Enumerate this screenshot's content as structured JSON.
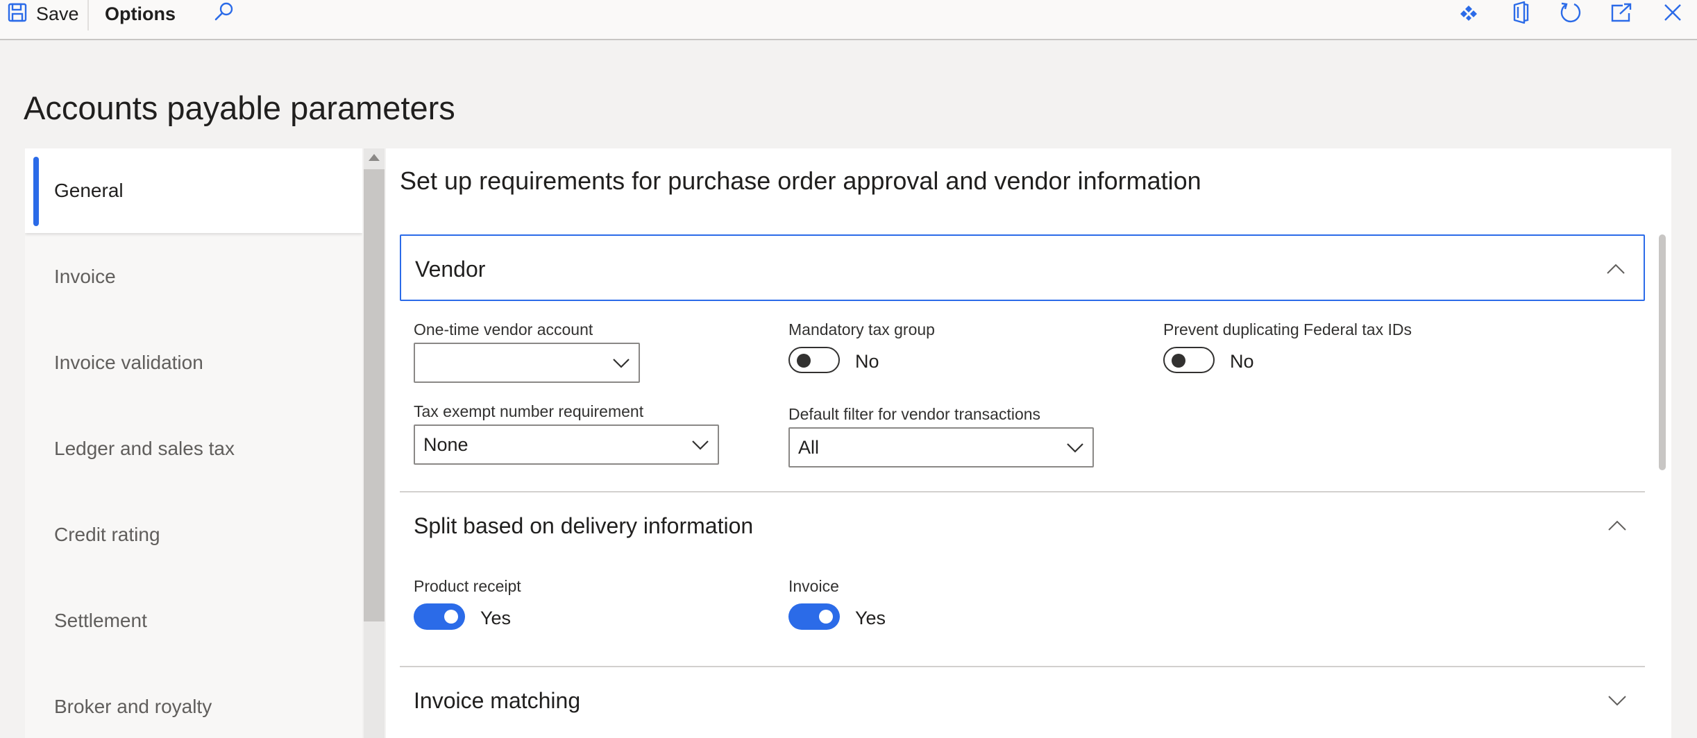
{
  "toolbar": {
    "save_label": "Save",
    "options_label": "Options",
    "icons": [
      "save-icon",
      "search-icon",
      "diamond-icon",
      "office-icon",
      "refresh-icon",
      "open-new-window-icon",
      "close-icon"
    ]
  },
  "page": {
    "title": "Accounts payable parameters"
  },
  "nav": {
    "items": [
      {
        "label": "General",
        "selected": true
      },
      {
        "label": "Invoice"
      },
      {
        "label": "Invoice validation"
      },
      {
        "label": "Ledger and sales tax"
      },
      {
        "label": "Credit rating"
      },
      {
        "label": "Settlement"
      },
      {
        "label": "Broker and royalty"
      }
    ]
  },
  "main": {
    "heading": "Set up requirements for purchase order approval and vendor information",
    "vendor": {
      "title": "Vendor",
      "one_time_vendor_account": {
        "label": "One-time vendor account",
        "value": ""
      },
      "mandatory_tax_group": {
        "label": "Mandatory tax group",
        "state": "No"
      },
      "prevent_duplicating": {
        "label": "Prevent duplicating Federal tax IDs",
        "state": "No"
      },
      "tax_exempt": {
        "label": "Tax exempt number requirement",
        "value": "None"
      },
      "default_filter": {
        "label": "Default filter for vendor transactions",
        "value": "All"
      }
    },
    "split": {
      "title": "Split based on delivery information",
      "product_receipt": {
        "label": "Product receipt",
        "state": "Yes"
      },
      "invoice": {
        "label": "Invoice",
        "state": "Yes"
      }
    },
    "invoice_matching": {
      "title": "Invoice matching"
    }
  },
  "colors": {
    "accent": "#2b6be8",
    "background": "#f3f2f1",
    "panel": "#ffffff"
  }
}
